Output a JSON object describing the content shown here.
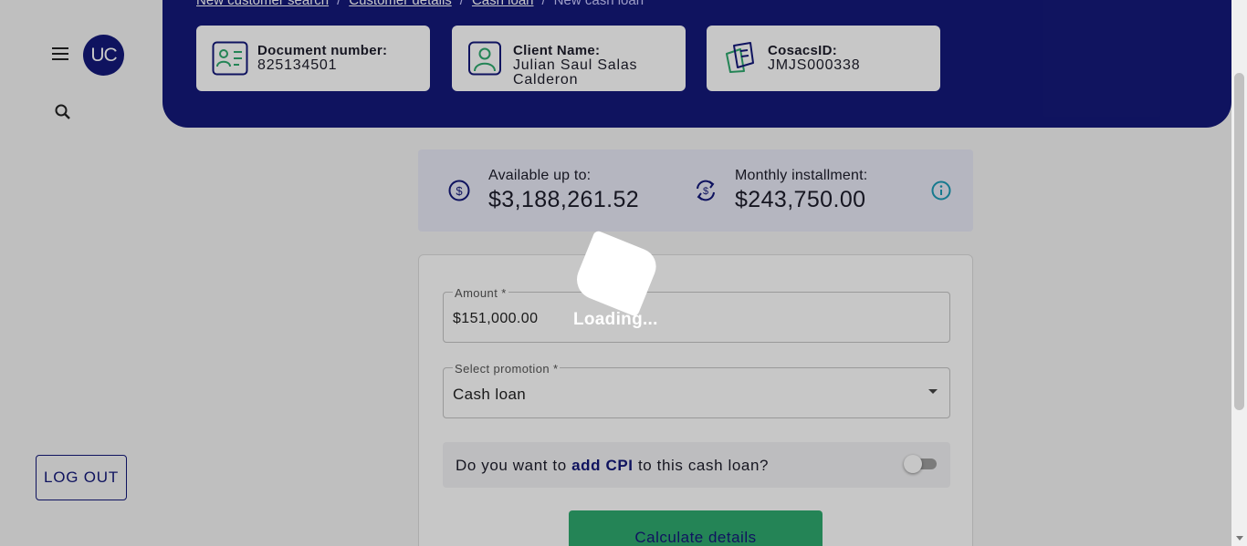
{
  "sidebar": {
    "avatar_initials": "UC",
    "logout_label": "LOG OUT"
  },
  "breadcrumb": {
    "items": [
      "New customer search",
      "Customer details",
      "Cash loan"
    ],
    "separator": "/",
    "current": "New cash loan"
  },
  "cards": {
    "document": {
      "label": "Document number:",
      "value": "825134501",
      "icon": "id-card-icon"
    },
    "client": {
      "label": "Client Name:",
      "value": "Julian Saul Salas Calderon",
      "icon": "user-profile-icon"
    },
    "cosacs": {
      "label": "CosacsID:",
      "value": "JMJS000338",
      "icon": "cosacs-logo-icon"
    }
  },
  "summary": {
    "available_label": "Available up to:",
    "available_value": "$3,188,261.52",
    "installment_label": "Monthly installment:",
    "installment_value": "$243,750.00"
  },
  "form": {
    "amount_label": "Amount *",
    "amount_value": "$151,000.00",
    "promotion_label": "Select promotion *",
    "promotion_value": "Cash loan",
    "cpi_prefix": "Do you want to",
    "cpi_highlight": "add CPI",
    "cpi_suffix": "to this cash loan?",
    "cpi_enabled": false,
    "calculate_label": "Calculate details"
  },
  "overlay": {
    "loading_text": "Loading..."
  },
  "colors": {
    "primary": "#14197a",
    "accent_green": "#2faa6f",
    "info_teal": "#1c9bb6"
  }
}
